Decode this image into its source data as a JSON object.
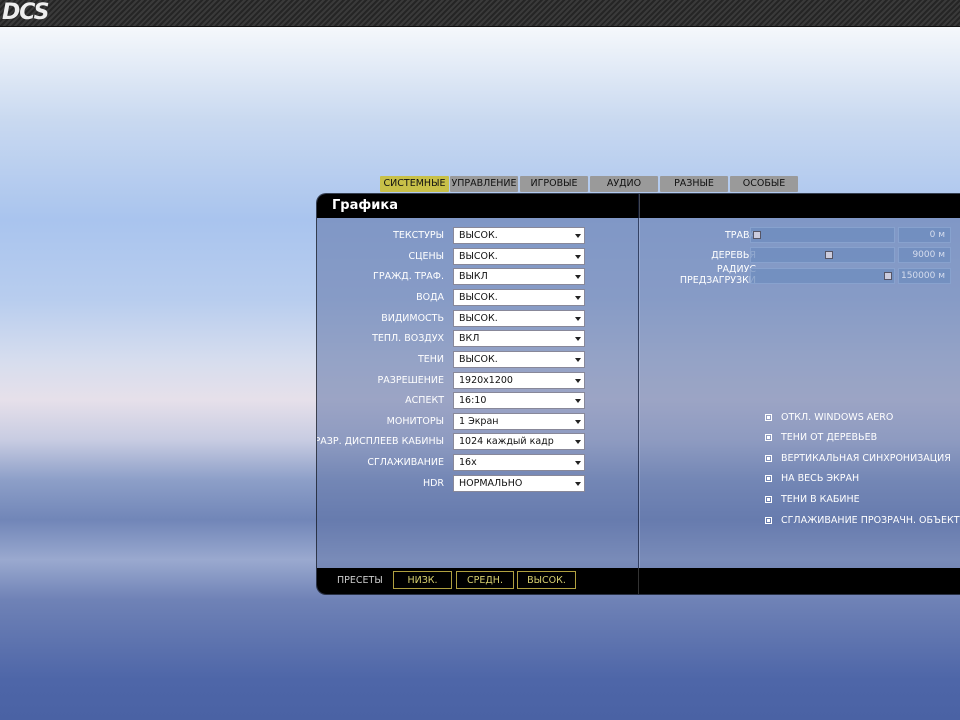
{
  "app": {
    "logo": "DCS"
  },
  "tabs": [
    {
      "label": "СИСТЕМНЫЕ",
      "active": true
    },
    {
      "label": "УПРАВЛЕНИЕ",
      "active": false
    },
    {
      "label": "ИГРОВЫЕ",
      "active": false
    },
    {
      "label": "АУДИО",
      "active": false
    },
    {
      "label": "РАЗНЫЕ",
      "active": false
    },
    {
      "label": "ОСОБЫЕ",
      "active": false
    }
  ],
  "panel": {
    "title": "Графика"
  },
  "settings": [
    {
      "label": "ТЕКСТУРЫ",
      "value": "ВЫСОК."
    },
    {
      "label": "СЦЕНЫ",
      "value": "ВЫСОК."
    },
    {
      "label": "ГРАЖД. ТРАФ.",
      "value": "ВЫКЛ"
    },
    {
      "label": "ВОДА",
      "value": "ВЫСОК."
    },
    {
      "label": "ВИДИМОСТЬ",
      "value": "ВЫСОК."
    },
    {
      "label": "ТЕПЛ. ВОЗДУХ",
      "value": "ВКЛ"
    },
    {
      "label": "ТЕНИ",
      "value": "ВЫСОК."
    },
    {
      "label": "РАЗРЕШЕНИЕ",
      "value": "1920x1200"
    },
    {
      "label": "АСПЕКТ",
      "value": "16:10"
    },
    {
      "label": "МОНИТОРЫ",
      "value": "1 Экран"
    },
    {
      "label": "РАЗР. ДИСПЛЕЕВ КАБИНЫ",
      "value": "1024 каждый кадр"
    },
    {
      "label": "СГЛАЖИВАНИЕ",
      "value": "16x"
    },
    {
      "label": "HDR",
      "value": "НОРМАЛЬНО"
    }
  ],
  "sliders": [
    {
      "label": "ТРАВА",
      "readout": "0 м",
      "level": 0.0
    },
    {
      "label": "ДЕРЕВЬЯ",
      "readout": "9000 м",
      "level": 0.55
    },
    {
      "label_line1": "РАДИУС",
      "label_line2": "ПРЕДЗАГРУЗКИ",
      "readout": "150000 м",
      "level": 1.0
    }
  ],
  "checkboxes": [
    {
      "label": "ОТКЛ. WINDOWS AERO",
      "checked": true
    },
    {
      "label": "ТЕНИ ОТ ДЕРЕВЬЕВ",
      "checked": true
    },
    {
      "label": "ВЕРТИКАЛЬНАЯ СИНХРОНИЗАЦИЯ",
      "checked": true
    },
    {
      "label": "НА ВЕСЬ ЭКРАН",
      "checked": true
    },
    {
      "label": "ТЕНИ В КАБИНЕ",
      "checked": true
    },
    {
      "label": "СГЛАЖИВАНИЕ ПРОЗРАЧН. ОБЪЕКТ.",
      "checked": true
    }
  ],
  "presets": {
    "label": "ПРЕСЕТЫ",
    "buttons": [
      "НИЗК.",
      "СРЕДН.",
      "ВЫСОК."
    ]
  }
}
